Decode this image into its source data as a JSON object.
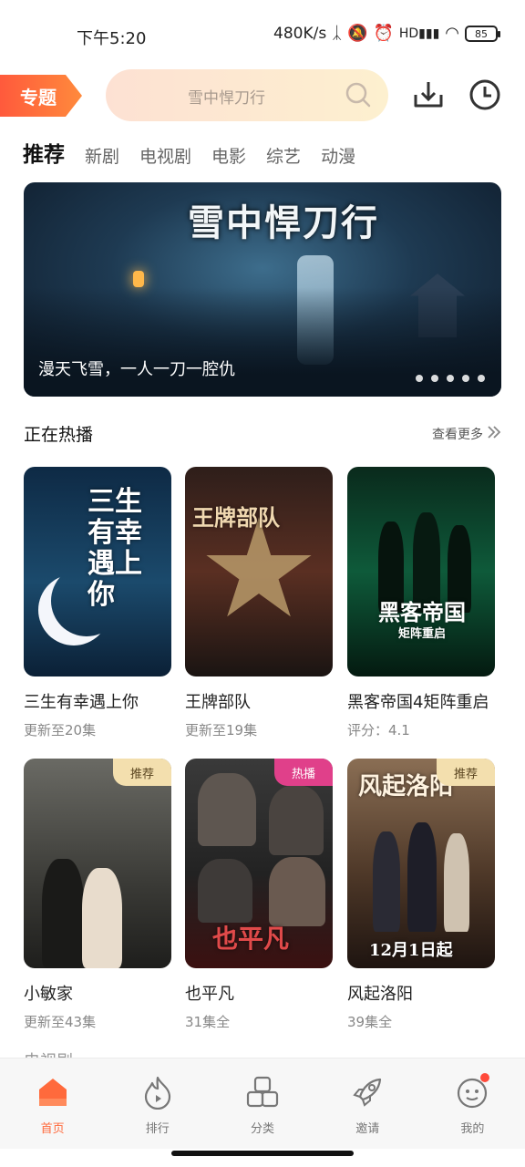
{
  "status_bar": {
    "time": "下午5:20",
    "network_speed": "480K/s",
    "battery": "85"
  },
  "header": {
    "topic_label": "专题",
    "search_placeholder": "雪中悍刀行"
  },
  "tabs": [
    {
      "label": "推荐",
      "active": true
    },
    {
      "label": "新剧"
    },
    {
      "label": "电视剧"
    },
    {
      "label": "电影"
    },
    {
      "label": "综艺"
    },
    {
      "label": "动漫"
    }
  ],
  "banner": {
    "poster_title": "雪中悍刀行",
    "caption": "漫天飞雪，一人一刀一腔仇",
    "dot_count": 5
  },
  "section": {
    "title": "正在热播",
    "more_label": "查看更多"
  },
  "cards": [
    {
      "title": "三生有幸遇上你",
      "subtitle": "更新至20集",
      "poster_text": "三生有幸遇上你"
    },
    {
      "title": "王牌部队",
      "subtitle": "更新至19集",
      "poster_text": "王牌部队"
    },
    {
      "title": "黑客帝国4矩阵重启",
      "subtitle": "评分：4.1",
      "poster_text": "黑客帝国",
      "poster_sub": "矩阵重启"
    },
    {
      "title": "小敏家",
      "subtitle": "更新至43集",
      "badge": "推荐"
    },
    {
      "title": "也平凡",
      "subtitle": "31集全",
      "badge": "热播",
      "poster_text": "也平凡"
    },
    {
      "title": "风起洛阳",
      "subtitle": "39集全",
      "badge": "推荐",
      "poster_text": "风起洛阳",
      "poster_sub": "12月1日起"
    }
  ],
  "next_section_peek": "电视剧",
  "bottom_nav": [
    {
      "label": "首页",
      "icon": "home-icon",
      "active": true
    },
    {
      "label": "排行",
      "icon": "flame-icon"
    },
    {
      "label": "分类",
      "icon": "category-icon"
    },
    {
      "label": "邀请",
      "icon": "rocket-icon"
    },
    {
      "label": "我的",
      "icon": "profile-icon"
    }
  ],
  "colors": {
    "accent": "#ff6a3c",
    "hot_badge": "#e0408a",
    "recommend_badge": "#f3dfae"
  }
}
